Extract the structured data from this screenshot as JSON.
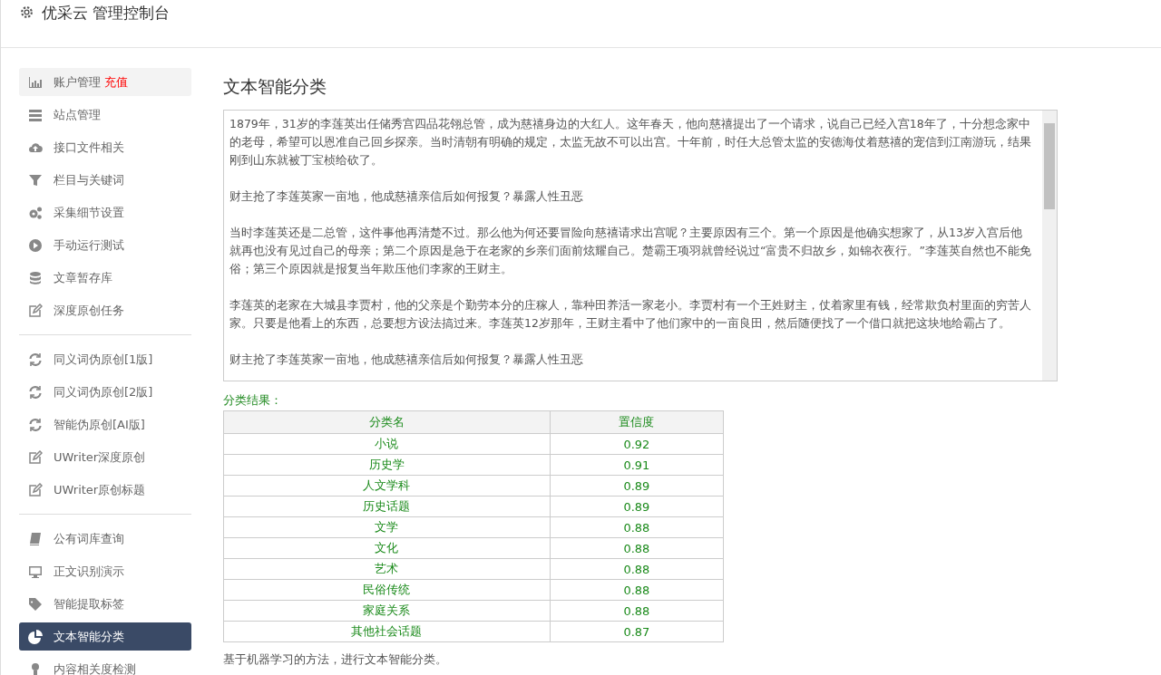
{
  "header": {
    "title": "优采云 管理控制台"
  },
  "sidebar": {
    "groups": [
      {
        "items": [
          {
            "label": "账户管理",
            "badge": "充值",
            "hovered": true,
            "selected": false
          },
          {
            "label": "站点管理",
            "hovered": false,
            "selected": false
          },
          {
            "label": "接口文件相关",
            "hovered": false,
            "selected": false
          },
          {
            "label": "栏目与关键词",
            "hovered": false,
            "selected": false
          },
          {
            "label": "采集细节设置",
            "hovered": false,
            "selected": false
          },
          {
            "label": "手动运行测试",
            "hovered": false,
            "selected": false
          },
          {
            "label": "文章暂存库",
            "hovered": false,
            "selected": false
          },
          {
            "label": "深度原创任务",
            "hovered": false,
            "selected": false
          }
        ]
      },
      {
        "items": [
          {
            "label": "同义词伪原创[1版]",
            "hovered": false,
            "selected": false
          },
          {
            "label": "同义词伪原创[2版]",
            "hovered": false,
            "selected": false
          },
          {
            "label": "智能伪原创[AI版]",
            "hovered": false,
            "selected": false
          },
          {
            "label": "UWriter深度原创",
            "hovered": false,
            "selected": false
          },
          {
            "label": "UWriter原创标题",
            "hovered": false,
            "selected": false
          }
        ]
      },
      {
        "items": [
          {
            "label": "公有词库查询",
            "hovered": false,
            "selected": false
          },
          {
            "label": "正文识别演示",
            "hovered": false,
            "selected": false
          },
          {
            "label": "智能提取标签",
            "hovered": false,
            "selected": false
          },
          {
            "label": "文本智能分类",
            "hovered": false,
            "selected": true
          },
          {
            "label": "内容相关度检测",
            "hovered": false,
            "selected": false
          }
        ]
      }
    ]
  },
  "main": {
    "title": "文本智能分类",
    "input_text": [
      "1879年，31岁的李莲英出任储秀宫四品花翎总管，成为慈禧身边的大红人。这年春天，他向慈禧提出了一个请求，说自己已经入宫18年了，十分想念家中的老母，希望可以恩准自己回乡探亲。当时清朝有明确的规定，太监无故不可以出宫。十年前，时任大总管太监的安德海仗着慈禧的宠信到江南游玩，结果刚到山东就被丁宝桢给砍了。",
      "财主抢了李莲英家一亩地，他成慈禧亲信后如何报复？暴露人性丑恶",
      "当时李莲英还是二总管，这件事他再清楚不过。那么他为何还要冒险向慈禧请求出宫呢？主要原因有三个。第一个原因是他确实想家了，从13岁入宫后他就再也没有见过自己的母亲；第二个原因是急于在老家的乡亲们面前炫耀自己。楚霸王项羽就曾经说过“富贵不归故乡，如锦衣夜行。”李莲英自然也不能免俗；第三个原因就是报复当年欺压他们李家的王财主。",
      "李莲英的老家在大城县李贾村，他的父亲是个勤劳本分的庄稼人，靠种田养活一家老小。李贾村有一个王姓财主，仗着家里有钱，经常欺负村里面的穷苦人家。只要是他看上的东西，总要想方设法搞过来。李莲英12岁那年，王财主看中了他们家中的一亩良田，然后随便找了一个借口就把这块地给霸占了。",
      "财主抢了李莲英家一亩地，他成慈禧亲信后如何报复？暴露人性丑恶"
    ],
    "result_label": "分类结果：",
    "table": {
      "columns": [
        "分类名",
        "置信度"
      ],
      "rows": [
        [
          "小说",
          "0.92"
        ],
        [
          "历史学",
          "0.91"
        ],
        [
          "人文学科",
          "0.89"
        ],
        [
          "历史话题",
          "0.89"
        ],
        [
          "文学",
          "0.88"
        ],
        [
          "文化",
          "0.88"
        ],
        [
          "艺术",
          "0.88"
        ],
        [
          "民俗传统",
          "0.88"
        ],
        [
          "家庭关系",
          "0.88"
        ],
        [
          "其他社会话题",
          "0.87"
        ]
      ]
    },
    "footnote": "基于机器学习的方法，进行文本智能分类。"
  }
}
